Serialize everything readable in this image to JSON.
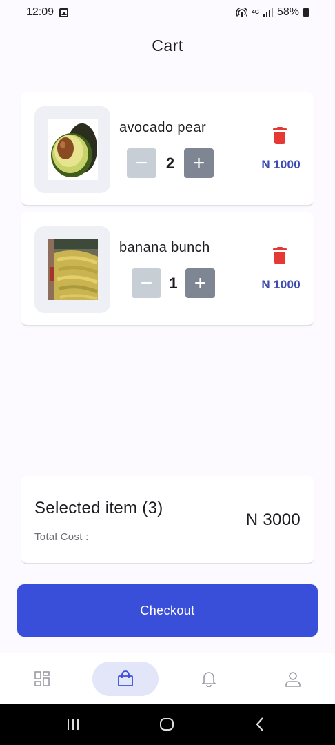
{
  "status_bar": {
    "time": "12:09",
    "network": "4G",
    "battery": "58%"
  },
  "page": {
    "title": "Cart"
  },
  "cart": {
    "items": [
      {
        "name": "avocado pear",
        "quantity": "2",
        "price": "N 1000",
        "minus": "−",
        "plus": "+"
      },
      {
        "name": "banana bunch",
        "quantity": "1",
        "price": "N 1000",
        "minus": "−",
        "plus": "+"
      }
    ]
  },
  "summary": {
    "title": "Selected item (3)",
    "subtitle": "Total Cost :",
    "total": "N 3000"
  },
  "checkout": {
    "label": "Checkout"
  },
  "bottom_nav": {
    "items": [
      {
        "icon": "grid-icon",
        "active": false
      },
      {
        "icon": "shopping-bag-icon",
        "active": true
      },
      {
        "icon": "bell-icon",
        "active": false
      },
      {
        "icon": "user-icon",
        "active": false
      }
    ]
  },
  "colors": {
    "accent": "#3a4fd9",
    "price": "#3b4bb0",
    "delete": "#e53935",
    "nav_active": "#e3e5f9"
  }
}
